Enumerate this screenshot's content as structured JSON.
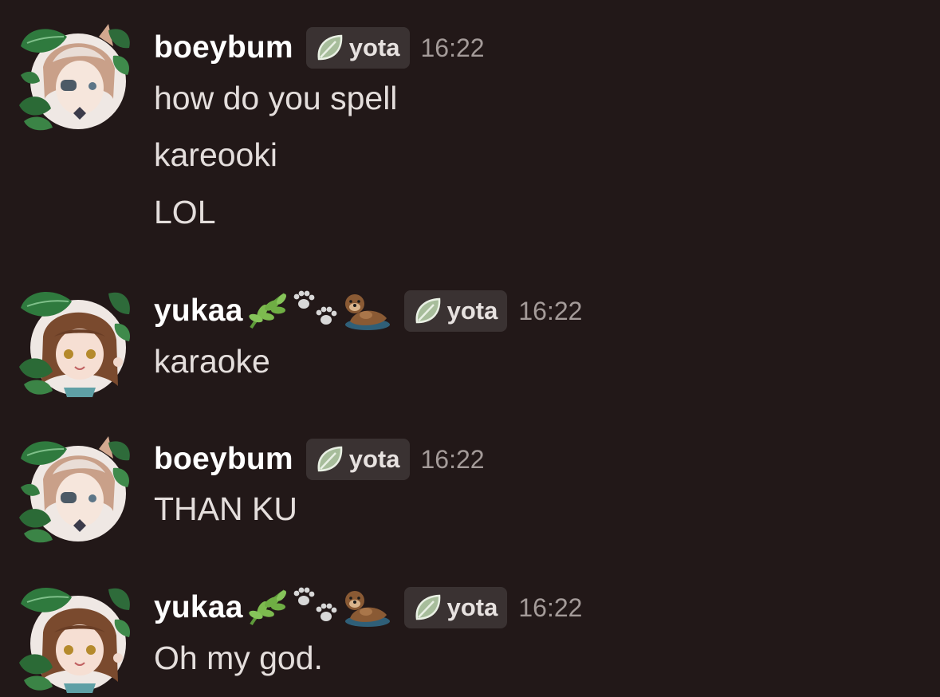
{
  "colors": {
    "background": "#221818",
    "username": "#ffffff",
    "message_text": "#e4dedc",
    "timestamp": "#a49b99",
    "tag_bg": "#3a3232",
    "leaf": "#9cb391"
  },
  "messages": [
    {
      "author": "boeybum",
      "tag": "yota",
      "time": "16:22",
      "lines": [
        "how do you spell",
        "kareooki",
        "LOL"
      ],
      "icons": [
        "leaf-icon"
      ]
    },
    {
      "author": "yukaa",
      "tag": "yota",
      "time": "16:22",
      "lines": [
        "karaoke"
      ],
      "icons": [
        "herb-icon",
        "paw-prints-icon",
        "otter-icon",
        "leaf-icon"
      ]
    },
    {
      "author": "boeybum",
      "tag": "yota",
      "time": "16:22",
      "lines": [
        "THAN KU"
      ],
      "icons": [
        "leaf-icon"
      ]
    },
    {
      "author": "yukaa",
      "tag": "yota",
      "time": "16:22",
      "lines": [
        "Oh my god."
      ],
      "icons": [
        "herb-icon",
        "paw-prints-icon",
        "otter-icon",
        "leaf-icon"
      ]
    }
  ]
}
